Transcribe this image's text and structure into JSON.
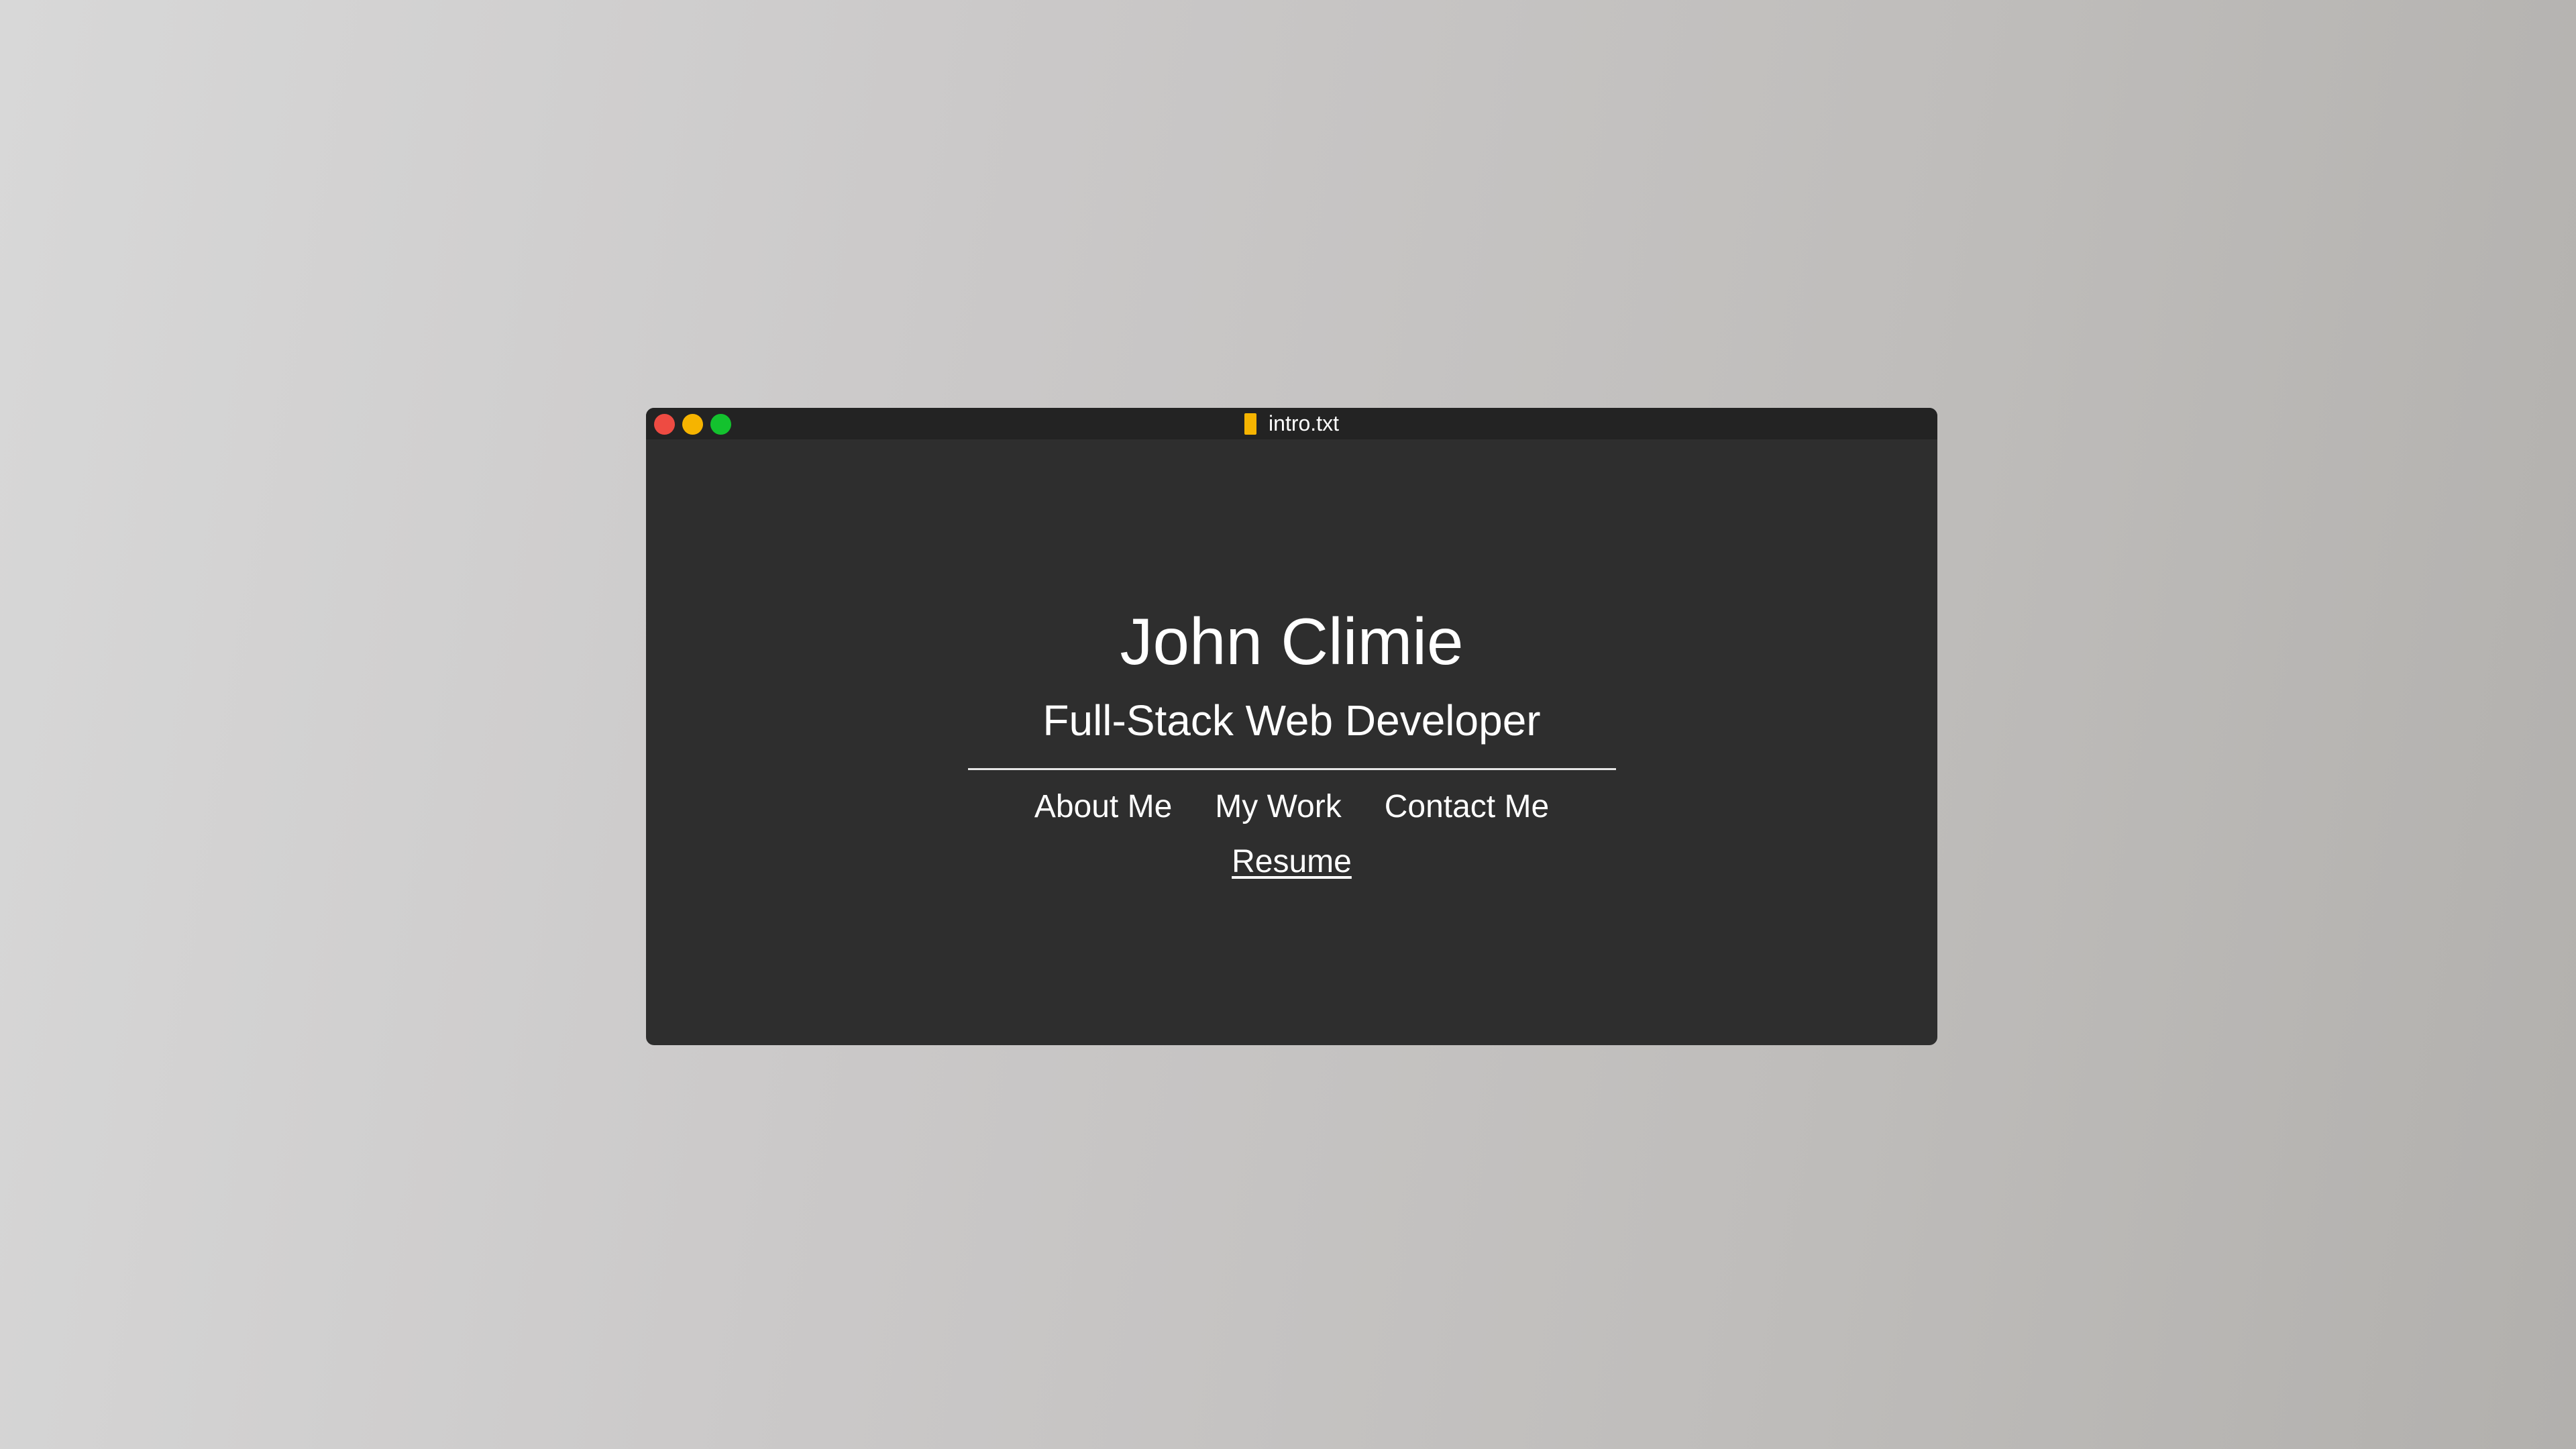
{
  "colors": {
    "close": "#ee4b42",
    "minimize": "#f6b400",
    "maximize": "#13c22e",
    "file_icon": "#f6b400",
    "window_bg": "#2e2e2e",
    "titlebar_bg": "#232323",
    "text": "#ffffff"
  },
  "window": {
    "title": "intro.txt",
    "file_icon": "file-icon"
  },
  "hero": {
    "name": "John Climie",
    "role": "Full-Stack Web Developer"
  },
  "nav": {
    "items": [
      {
        "label": "About Me"
      },
      {
        "label": "My Work"
      },
      {
        "label": "Contact Me"
      }
    ],
    "resume_label": "Resume"
  }
}
